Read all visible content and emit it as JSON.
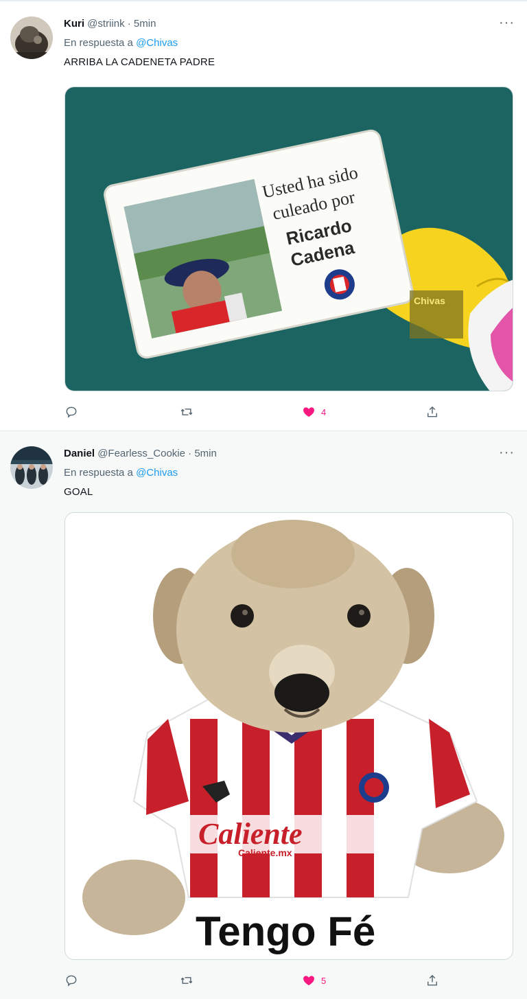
{
  "tweets": [
    {
      "display_name": "Kuri",
      "handle": "@striink",
      "time": "5min",
      "reply_prefix": "En respuesta a",
      "reply_mention": "@Chivas",
      "text": "ARRIBA LA CADENETA PADRE",
      "image_text": {
        "line1": "Usted ha sido",
        "line2": "culeado por",
        "name1": "Ricardo",
        "name2": "Cadena",
        "watermark": "Chivas"
      },
      "likes": "4"
    },
    {
      "display_name": "Daniel",
      "handle": "@Fearless_Cookie",
      "time": "5min",
      "reply_prefix": "En respuesta a",
      "reply_mention": "@Chivas",
      "text": "GOAL",
      "image_text": {
        "sponsor": "Caliente",
        "sponsor_url": "Caliente.mx",
        "caption": "Tengo Fé"
      },
      "likes": "5"
    }
  ],
  "icons": [
    "more-icon",
    "reply-icon",
    "retweet-icon",
    "like-icon",
    "share-icon"
  ],
  "colors": {
    "like_active": "#f91880",
    "mention": "#1d9bf0",
    "secondary_text": "#536471"
  }
}
